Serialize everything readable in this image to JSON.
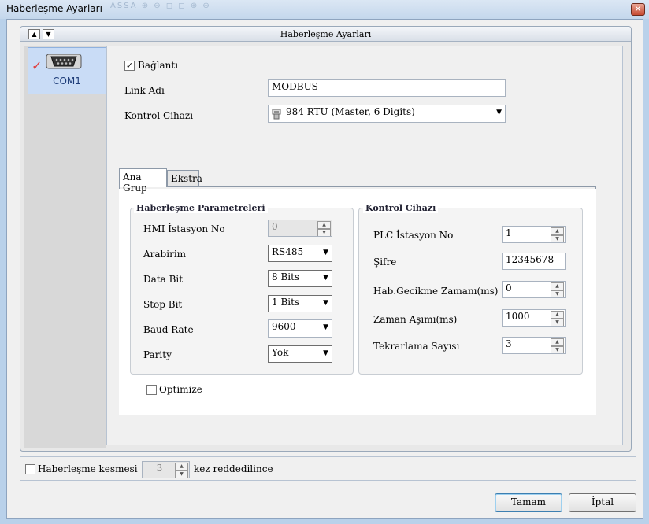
{
  "window": {
    "title": "Haberleşme Ayarları",
    "close_symbol": "✕",
    "ghost_toolbar": "ASSA  ⊕ ⊖ ◻ ◻ ⊕ ⊕"
  },
  "panel": {
    "header": "Haberleşme Ayarları",
    "up_arrow": "▲",
    "down_arrow": "▼"
  },
  "ports": [
    {
      "label": "COM1",
      "selected": true,
      "check": "✓"
    }
  ],
  "connection": {
    "checkbox_label": "Bağlantı",
    "checked": true,
    "check": "✓"
  },
  "link_name": {
    "label": "Link Adı",
    "value": "MODBUS"
  },
  "controller": {
    "label": "Kontrol Cihazı",
    "value": "984 RTU (Master, 6 Digits)"
  },
  "tabs": [
    {
      "label": "Ana Grup",
      "active": true
    },
    {
      "label": "Ekstra",
      "active": false
    }
  ],
  "comm_params": {
    "title": "Haberleşme Parametreleri",
    "hmi_station": {
      "label": "HMI İstasyon No",
      "value": "0"
    },
    "interface": {
      "label": "Arabirim",
      "value": "RS485"
    },
    "data_bit": {
      "label": "Data Bit",
      "value": "8 Bits"
    },
    "stop_bit": {
      "label": "Stop Bit",
      "value": "1 Bits"
    },
    "baud_rate": {
      "label": "Baud Rate",
      "value": "9600"
    },
    "parity": {
      "label": "Parity",
      "value": "Yok"
    }
  },
  "controller_group": {
    "title": "Kontrol Cihazı",
    "plc_station": {
      "label": "PLC İstasyon No",
      "value": "1"
    },
    "password": {
      "label": "Şifre",
      "value": "12345678"
    },
    "delay": {
      "label": "Hab.Gecikme Zamanı(ms)",
      "value": "0"
    },
    "timeout": {
      "label": "Zaman Aşımı(ms)",
      "value": "1000"
    },
    "retry": {
      "label": "Tekrarlama Sayısı",
      "value": "3"
    }
  },
  "optimize": {
    "label": "Optimize",
    "checked": false
  },
  "comm_break": {
    "label": "Haberleşme kesmesi",
    "checked": false,
    "count": "3",
    "suffix": "kez reddedilince"
  },
  "buttons": {
    "ok": "Tamam",
    "cancel": "İptal"
  },
  "glyphs": {
    "dropdown": "▼",
    "spin_up": "▲",
    "spin_down": "▼"
  }
}
